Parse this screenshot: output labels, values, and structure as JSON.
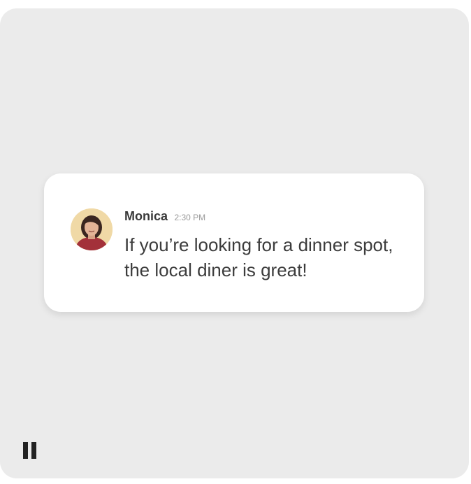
{
  "message": {
    "sender_name": "Monica",
    "timestamp": "2:30 PM",
    "text": "If you’re looking for a dinner spot, the local diner is great!"
  },
  "controls": {
    "pause_icon": "pause-icon"
  },
  "colors": {
    "stage_background": "#ebebeb",
    "card_background": "#ffffff",
    "name_text": "#3a3a3a",
    "timestamp_text": "#9a9a9a",
    "message_text": "#3c3c3c",
    "avatar_background": "#f0d9a6"
  }
}
